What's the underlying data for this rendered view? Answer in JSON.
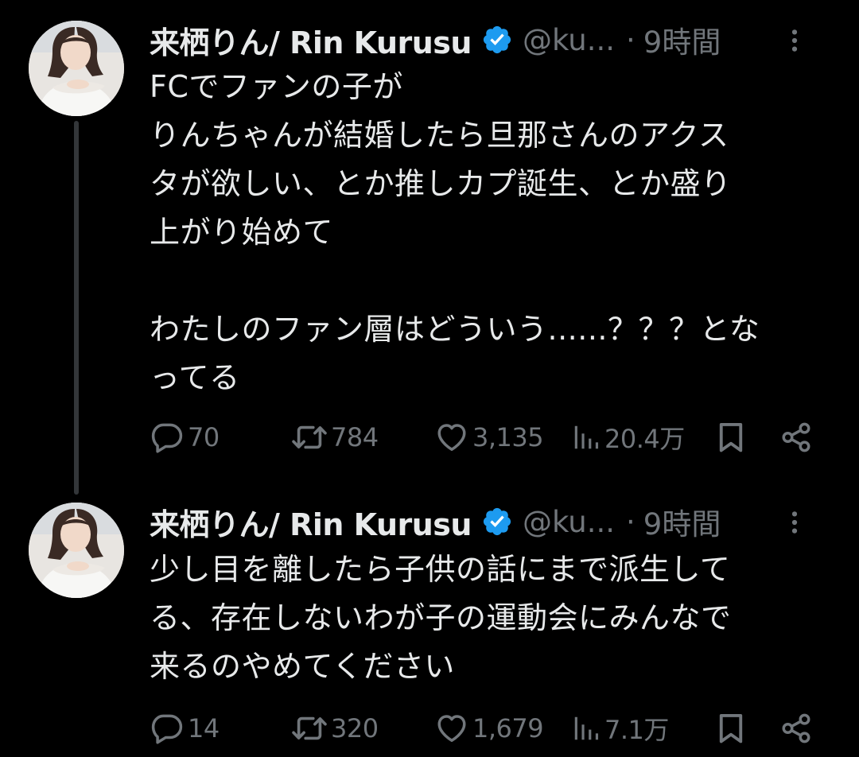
{
  "colors": {
    "background": "#000000",
    "text_primary": "#e7e9ea",
    "text_secondary": "#71767b",
    "verified_blue": "#1d9bf0",
    "thread_line": "#333639"
  },
  "tweets": [
    {
      "author": {
        "display_name": "来栖りん/ Rin Kurusu",
        "handle": "@ku...",
        "verified_icon": "verified-badge-icon",
        "avatar": "profile-photo"
      },
      "separator": "·",
      "time": "9時間",
      "menu_icon": "more-vertical-icon",
      "text": "FCでファンの子が\nりんちゃんが結婚したら旦那さんのアクス\nタが欲しい、とか推しカプ誕生、とか盛り\n上がり始めて\n\nわたしのファン層はどういう......？？？とな\nってる",
      "actions": {
        "replies": "70",
        "retweets": "784",
        "likes": "3,135",
        "views": "20.4万"
      }
    },
    {
      "author": {
        "display_name": "来栖りん/ Rin Kurusu",
        "handle": "@ku...",
        "verified_icon": "verified-badge-icon",
        "avatar": "profile-photo"
      },
      "separator": "·",
      "time": "9時間",
      "menu_icon": "more-vertical-icon",
      "text": "少し目を離したら子供の話にまで派生して\nる、存在しないわが子の運動会にみんなで\n来るのやめてください",
      "actions": {
        "replies": "14",
        "retweets": "320",
        "likes": "1,679",
        "views": "7.1万"
      }
    }
  ],
  "action_icons": [
    "reply-icon",
    "retweet-icon",
    "like-icon",
    "views-icon",
    "bookmark-icon",
    "share-icon"
  ]
}
